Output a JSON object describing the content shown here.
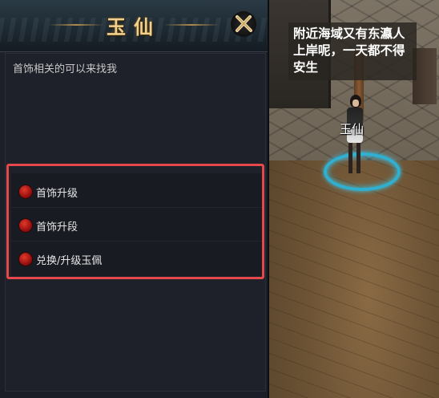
{
  "dialog": {
    "title": "玉仙",
    "greeting": "首饰相关的可以来找我",
    "options": [
      {
        "label": "首饰升级"
      },
      {
        "label": "首饰升段"
      },
      {
        "label": "兑换/升级玉佩"
      }
    ]
  },
  "world": {
    "npc_name": "玉仙",
    "speech": "附近海域又有东瀛人上岸呢，一天都不得安生"
  },
  "colors": {
    "title_gold": "#f2d08a",
    "highlight_red": "#e4484a",
    "option_dot_red": "#c21e14",
    "ring_cyan": "#2fb0d0"
  },
  "icons": {
    "close": "close-x-icon",
    "option_bullet": "red-orb-icon"
  }
}
